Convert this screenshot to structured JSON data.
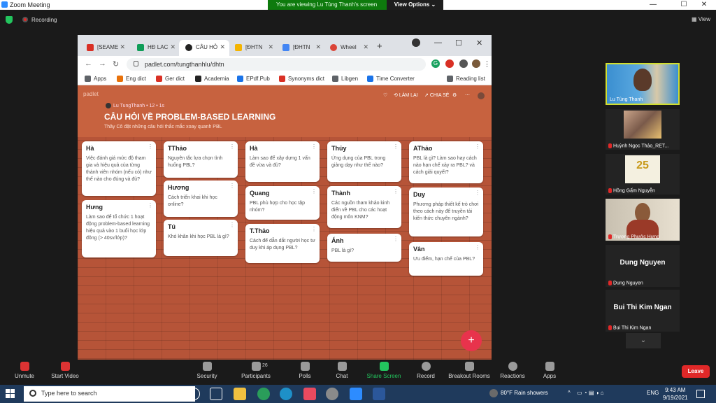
{
  "zoom": {
    "title": "Zoom Meeting",
    "banner": "You are viewing Lu Tùng Thanh's screen",
    "view_options": "View Options ⌄",
    "recording": "Recording",
    "view": "View",
    "win_min": "—",
    "win_max": "☐",
    "win_close": "✕",
    "chevron": "⌄"
  },
  "browser": {
    "tabs": [
      {
        "label": "[SEAME",
        "color": "#d93025"
      },
      {
        "label": "HĐ LAC",
        "color": "#0f9d58"
      },
      {
        "label": "CÂU HỎ",
        "color": "#222222"
      },
      {
        "label": "[ĐHTN",
        "color": "#f4b400"
      },
      {
        "label": "[ĐHTN",
        "color": "#4285f4"
      },
      {
        "label": "Wheel",
        "color": "#db4437"
      }
    ],
    "close_glyph": "✕",
    "new_tab": "+",
    "url": "padlet.com/tungthanhlu/dhtn",
    "bookmarks": [
      {
        "label": "Apps",
        "color": "#5f6368"
      },
      {
        "label": "Eng dict",
        "color": "#e8710a"
      },
      {
        "label": "Ger dict",
        "color": "#d93025"
      },
      {
        "label": "Academia",
        "color": "#222222"
      },
      {
        "label": "EPdf.Pub",
        "color": "#1a73e8"
      },
      {
        "label": "Synonyms dict",
        "color": "#d93025"
      },
      {
        "label": "Libgen",
        "color": "#5f6368"
      },
      {
        "label": "Time Converter",
        "color": "#1a73e8"
      }
    ],
    "reading_list": "Reading list"
  },
  "padlet": {
    "logo": "padlet",
    "author": "Lu TungThanh • 12 • 1s",
    "title": "CÂU HỎI VỀ PROBLEM-BASED LEARNING",
    "desc": "Thầy Cô đặt những câu hỏi thắc mắc xoay quanh PBL",
    "remake": "LÀM LẠI",
    "share": "CHIA SẺ",
    "heart": "♡",
    "gear": "⚙",
    "more": "⋯",
    "card_more": "⋮",
    "add": "+",
    "cards": [
      {
        "name": "Hà",
        "text": "Việc đánh giá mức độ tham gia và hiệu quả của từng thành viên nhóm (nếu có) như thế nào cho đúng và đủ?"
      },
      {
        "name": "Hưng",
        "text": "Làm sao để tổ chức 1 hoạt động problem-based learning hiệu quả vào 1 buổi học lớp đông (> 40sv/lớp)?"
      },
      {
        "name": "TThảo",
        "text": "Nguyên tắc lựa chọn tình huống PBL?"
      },
      {
        "name": "Hương",
        "text": "Cách triển khai khi học online?"
      },
      {
        "name": "Tú",
        "text": "Khó khăn khi học PBL là gì?"
      },
      {
        "name": "Hà",
        "text": "Làm sao để xây dựng 1 vấn đề vừa và đủ?"
      },
      {
        "name": "Quang",
        "text": "PBL phù hợp cho học tập nhóm?"
      },
      {
        "name": "T.Thảo",
        "text": "Cách để dẫn dắt người học tư duy khi áp dụng PBL?"
      },
      {
        "name": "Thủy",
        "text": "Ứng dụng của PBL trong giảng dạy như thế nào?"
      },
      {
        "name": "Thành",
        "text": "Các nguồn tham khảo kinh điển về PBL cho các hoạt động môn KNM?"
      },
      {
        "name": "Ánh",
        "text": "PBL là gì?"
      },
      {
        "name": "AThảo",
        "text": "PBL là gì? Làm sao hay cách nào hạn chế xảy ra PBL? và cách giải quyết?"
      },
      {
        "name": "Duy",
        "text": "Phương pháp thiết kế trò chơi theo cách này để truyền tải kiến thức chuyên ngành?"
      },
      {
        "name": "Vân",
        "text": "Ưu điểm, hạn chế của PBL?"
      }
    ]
  },
  "participants": [
    {
      "name": "Lu Tùng Thanh",
      "active": true,
      "muted": false,
      "big": ""
    },
    {
      "name": "Huỳnh Ngọc Thảo_RET...",
      "active": false,
      "muted": true,
      "big": ""
    },
    {
      "name": "Hồng Gấm Nguyễn",
      "active": false,
      "muted": true,
      "big": "25"
    },
    {
      "name": "Trương Phước Hưng",
      "active": false,
      "muted": true,
      "big": ""
    },
    {
      "name": "Dung Nguyen",
      "active": false,
      "muted": true,
      "big": "Dung Nguyen"
    },
    {
      "name": "Bui Thi Kim Ngan",
      "active": false,
      "muted": true,
      "big": "Bui Thi Kim Ngan"
    }
  ],
  "toolbar": {
    "unmute": "Unmute",
    "start_video": "Start Video",
    "security": "Security",
    "participants": "Participants",
    "participants_count": "26",
    "polls": "Polls",
    "chat": "Chat",
    "share_screen": "Share Screen",
    "record": "Record",
    "breakout": "Breakout Rooms",
    "reactions": "Reactions",
    "apps": "Apps",
    "leave": "Leave"
  },
  "taskbar": {
    "search": "Type here to search",
    "weather": "80°F  Rain showers",
    "lang": "ENG",
    "time": "9:43 AM",
    "date": "9/19/2021"
  },
  "colors": {
    "padlet_bg": "#b65438",
    "zoom_green": "#0e7a0d",
    "leave": "#e02828"
  }
}
